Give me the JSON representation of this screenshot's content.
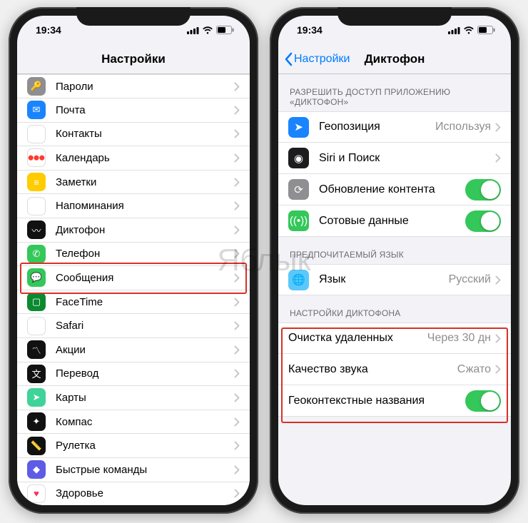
{
  "watermark": "Яблык",
  "status": {
    "time": "19:34"
  },
  "phone1": {
    "title": "Настройки",
    "items": [
      {
        "label": "Пароли",
        "icon": "key-icon",
        "bg": "bg-grey"
      },
      {
        "label": "Почта",
        "icon": "mail-icon",
        "bg": "bg-blue"
      },
      {
        "label": "Контакты",
        "icon": "contacts-icon",
        "bg": "bg-white"
      },
      {
        "label": "Календарь",
        "icon": "calendar-icon",
        "bg": "img-cal"
      },
      {
        "label": "Заметки",
        "icon": "notes-icon",
        "bg": "bg-yellow"
      },
      {
        "label": "Напоминания",
        "icon": "reminders-icon",
        "bg": "bg-white"
      },
      {
        "label": "Диктофон",
        "icon": "voice-memos-icon",
        "bg": "bg-black"
      },
      {
        "label": "Телефон",
        "icon": "phone-icon",
        "bg": "bg-green"
      },
      {
        "label": "Сообщения",
        "icon": "messages-icon",
        "bg": "bg-green"
      },
      {
        "label": "FaceTime",
        "icon": "facetime-icon",
        "bg": "bg-darkgreen"
      },
      {
        "label": "Safari",
        "icon": "safari-icon",
        "bg": "bg-white"
      },
      {
        "label": "Акции",
        "icon": "stocks-icon",
        "bg": "bg-black"
      },
      {
        "label": "Перевод",
        "icon": "translate-icon",
        "bg": "bg-black"
      },
      {
        "label": "Карты",
        "icon": "maps-icon",
        "bg": "bg-mint"
      },
      {
        "label": "Компас",
        "icon": "compass-icon",
        "bg": "bg-black"
      },
      {
        "label": "Рулетка",
        "icon": "measure-icon",
        "bg": "bg-black"
      },
      {
        "label": "Быстрые команды",
        "icon": "shortcuts-icon",
        "bg": "bg-purple"
      },
      {
        "label": "Здоровье",
        "icon": "health-icon",
        "bg": "bg-white"
      }
    ]
  },
  "phone2": {
    "back": "Настройки",
    "title": "Диктофон",
    "section1": {
      "header": "РАЗРЕШИТЬ ДОСТУП ПРИЛОЖЕНИЮ «ДИКТОФОН»",
      "rows": [
        {
          "label": "Геопозиция",
          "value": "Используя",
          "type": "link",
          "icon": "location-icon",
          "bg": "bg-blue"
        },
        {
          "label": "Siri и Поиск",
          "type": "link",
          "icon": "siri-icon",
          "bg": "bg-darksiri"
        },
        {
          "label": "Обновление контента",
          "type": "toggle",
          "on": true,
          "icon": "refresh-icon",
          "bg": "bg-grey"
        },
        {
          "label": "Сотовые данные",
          "type": "toggle",
          "on": true,
          "icon": "cellular-icon",
          "bg": "bg-green"
        }
      ]
    },
    "section2": {
      "header": "ПРЕДПОЧИТАЕМЫЙ ЯЗЫК",
      "rows": [
        {
          "label": "Язык",
          "value": "Русский",
          "type": "link",
          "icon": "language-icon",
          "bg": "bg-cyan"
        }
      ]
    },
    "section3": {
      "header": "НАСТРОЙКИ ДИКТОФОНА",
      "rows": [
        {
          "label": "Очистка удаленных",
          "value": "Через 30 дн",
          "type": "link"
        },
        {
          "label": "Качество звука",
          "value": "Сжато",
          "type": "link"
        },
        {
          "label": "Геоконтекстные названия",
          "type": "toggle",
          "on": true
        }
      ]
    }
  }
}
